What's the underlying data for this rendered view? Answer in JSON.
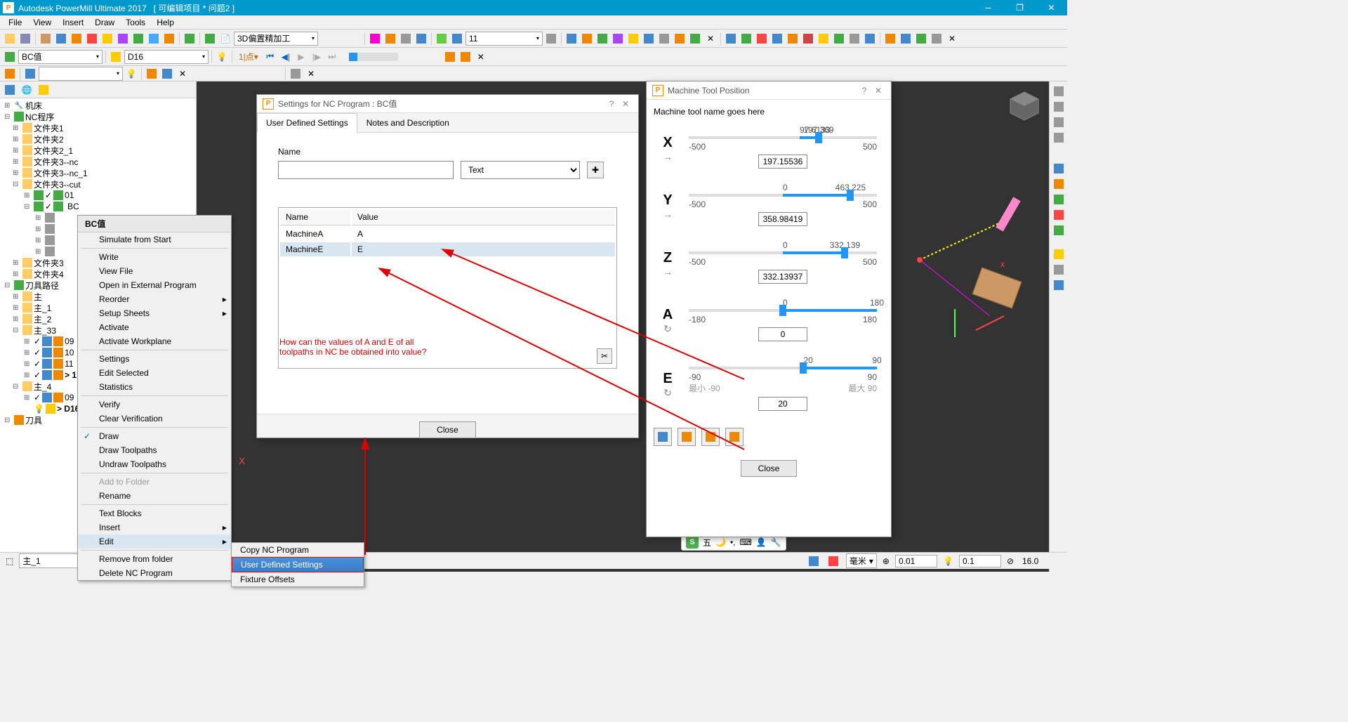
{
  "titlebar": {
    "app": "Autodesk PowerMill Ultimate 2017",
    "project": "[ 可编辑项目 * 问题2 ]"
  },
  "menubar": [
    "File",
    "View",
    "Insert",
    "Draw",
    "Tools",
    "Help"
  ],
  "toolbar2": {
    "strategy": "3D偏置精加工",
    "num": "11"
  },
  "toolbar3": {
    "combo1": "BC值",
    "combo2": "D16",
    "play_label": "1|点"
  },
  "tree": {
    "root1": "机床",
    "nc": "NC程序",
    "folders": [
      "文件夹1",
      "文件夹2",
      "文件夹2_1",
      "文件夹3--nc",
      "文件夹3--nc_1",
      "文件夹3--cut"
    ],
    "sub_items": [
      "01",
      "BC"
    ],
    "folders2": [
      "文件夹3",
      "文件夹4"
    ],
    "toolpaths": "刀具路径",
    "tp_items": [
      "主",
      "主_1",
      "主_2",
      "主_33"
    ],
    "tp_nums": [
      "09",
      "10",
      "11",
      "> 1"
    ],
    "tp_items2": [
      "主_4"
    ],
    "tp_nums2": [
      "09",
      "> D16"
    ],
    "tools": "刀具"
  },
  "context_menu": {
    "title": "BC值",
    "items": [
      {
        "label": "Simulate from Start"
      },
      {
        "sep": true
      },
      {
        "label": "Write"
      },
      {
        "label": "View File"
      },
      {
        "label": "Open in External Program"
      },
      {
        "label": "Reorder",
        "sub": true
      },
      {
        "label": "Setup Sheets",
        "sub": true
      },
      {
        "label": "Activate"
      },
      {
        "label": "Activate Workplane"
      },
      {
        "sep": true
      },
      {
        "label": "Settings"
      },
      {
        "label": "Edit Selected"
      },
      {
        "label": "Statistics"
      },
      {
        "sep": true
      },
      {
        "label": "Verify"
      },
      {
        "label": "Clear Verification"
      },
      {
        "sep": true
      },
      {
        "label": "Draw",
        "checked": true
      },
      {
        "label": "Draw Toolpaths"
      },
      {
        "label": "Undraw Toolpaths"
      },
      {
        "sep": true
      },
      {
        "label": "Add to Folder",
        "disabled": true
      },
      {
        "label": "Rename"
      },
      {
        "sep": true
      },
      {
        "label": "Text Blocks"
      },
      {
        "label": "Insert",
        "sub": true
      },
      {
        "label": "Edit",
        "sub": true,
        "hover": true
      },
      {
        "sep": true
      },
      {
        "label": "Remove from folder"
      },
      {
        "label": "Delete NC Program"
      }
    ],
    "submenu": [
      {
        "label": "Copy NC Program"
      },
      {
        "label": "User Defined Settings",
        "selected": true
      },
      {
        "label": "Fixture Offsets"
      }
    ]
  },
  "settings_dialog": {
    "title": "Settings for NC Program : BC值",
    "tabs": [
      "User Defined Settings",
      "Notes and Description"
    ],
    "name_label": "Name",
    "name_value": "",
    "type_value": "Text",
    "table_headers": [
      "Name",
      "Value"
    ],
    "rows": [
      {
        "name": "MachineA",
        "value": "A"
      },
      {
        "name": "MachineE",
        "value": "E"
      }
    ],
    "close": "Close"
  },
  "machine_dialog": {
    "title": "Machine Tool Position",
    "subtitle": "Machine tool name goes here",
    "axes": [
      {
        "label": "X",
        "top_a": "97.6133",
        "top_b": "197.369",
        "min": "-500",
        "max": "500",
        "value": "197.15536",
        "fill_l": 59,
        "fill_r": 69,
        "thumb": 69
      },
      {
        "label": "Y",
        "top_a": "0",
        "top_b": "463.225",
        "min": "-500",
        "max": "500",
        "value": "358.98419",
        "fill_l": 50,
        "fill_r": 86,
        "thumb": 86
      },
      {
        "label": "Z",
        "top_a": "0",
        "top_b": "332.139",
        "min": "-500",
        "max": "500",
        "value": "332.13937",
        "fill_l": 50,
        "fill_r": 83,
        "thumb": 83
      },
      {
        "label": "A",
        "top_a": "0",
        "top_b": "180",
        "min": "-180",
        "max": "180",
        "value": "0",
        "fill_l": 50,
        "fill_r": 100,
        "thumb": 50
      },
      {
        "label": "E",
        "top_a": "20",
        "top_b": "90",
        "min": "-90",
        "max": "90",
        "value": "20",
        "fill_l": 61,
        "fill_r": 100,
        "thumb": 61,
        "min_label": "最小 -90",
        "max_label": "最大 90"
      }
    ],
    "close": "Close"
  },
  "annotation": {
    "line1": "How can the values of A and E of all",
    "line2": " toolpaths in NC be obtained into value?"
  },
  "statusbar": {
    "combo1": "主_1",
    "unit": "毫米",
    "val1": "0.01",
    "val2": "0.1",
    "val3": "16.0",
    "ime": "五"
  }
}
